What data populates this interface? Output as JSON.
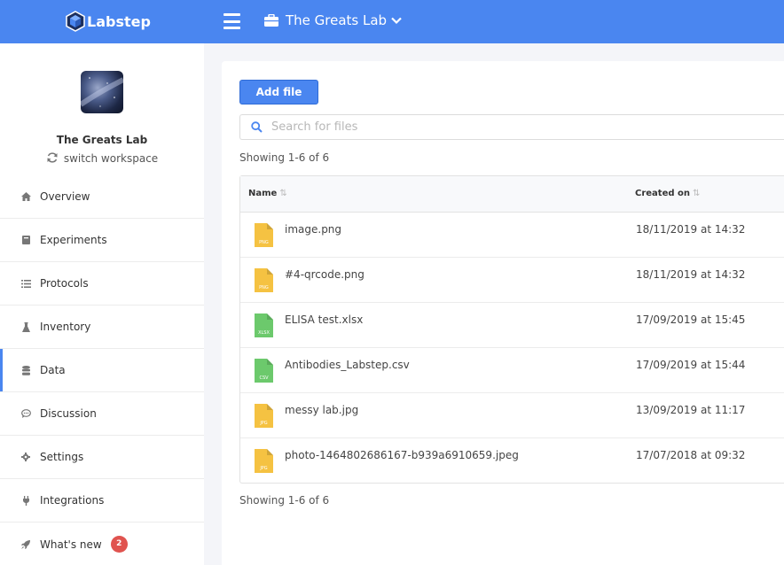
{
  "app": {
    "logo_text": "Labstep",
    "workspace_title": "The Greats Lab"
  },
  "sidebar": {
    "workspace_name": "The Greats Lab",
    "switch_label": "switch workspace",
    "items": [
      {
        "label": "Overview",
        "icon": "home-icon"
      },
      {
        "label": "Experiments",
        "icon": "notebook-icon"
      },
      {
        "label": "Protocols",
        "icon": "list-icon"
      },
      {
        "label": "Inventory",
        "icon": "flask-icon"
      },
      {
        "label": "Data",
        "icon": "database-icon",
        "active": true
      },
      {
        "label": "Discussion",
        "icon": "chat-icon"
      },
      {
        "label": "Settings",
        "icon": "gear-icon"
      },
      {
        "label": "Integrations",
        "icon": "plug-icon"
      },
      {
        "label": "What's new",
        "icon": "rocket-icon",
        "badge": "2"
      }
    ]
  },
  "main": {
    "add_button": "Add file",
    "search_placeholder": "Search for files",
    "showing_top": "Showing 1-6 of 6",
    "showing_bottom": "Showing 1-6 of 6",
    "columns": {
      "name": "Name",
      "created": "Created on"
    },
    "files": [
      {
        "name": "image.png",
        "created": "18/11/2019 at 14:32",
        "type": "PNG",
        "color": "#f5c242"
      },
      {
        "name": "#4-qrcode.png",
        "created": "18/11/2019 at 14:32",
        "type": "PNG",
        "color": "#f5c242"
      },
      {
        "name": "ELISA test.xlsx",
        "created": "17/09/2019 at 15:45",
        "type": "XLSX",
        "color": "#6cc96c"
      },
      {
        "name": "Antibodies_Labstep.csv",
        "created": "17/09/2019 at 15:44",
        "type": "CSV",
        "color": "#6cc96c"
      },
      {
        "name": "messy lab.jpg",
        "created": "13/09/2019 at 11:17",
        "type": "JPG",
        "color": "#f5c242"
      },
      {
        "name": "photo-1464802686167-b939a6910659.jpeg",
        "created": "17/07/2018 at 09:32",
        "type": "JPG",
        "color": "#f5c242"
      }
    ]
  },
  "colors": {
    "accent": "#4a86f0",
    "badge": "#e0534f"
  }
}
